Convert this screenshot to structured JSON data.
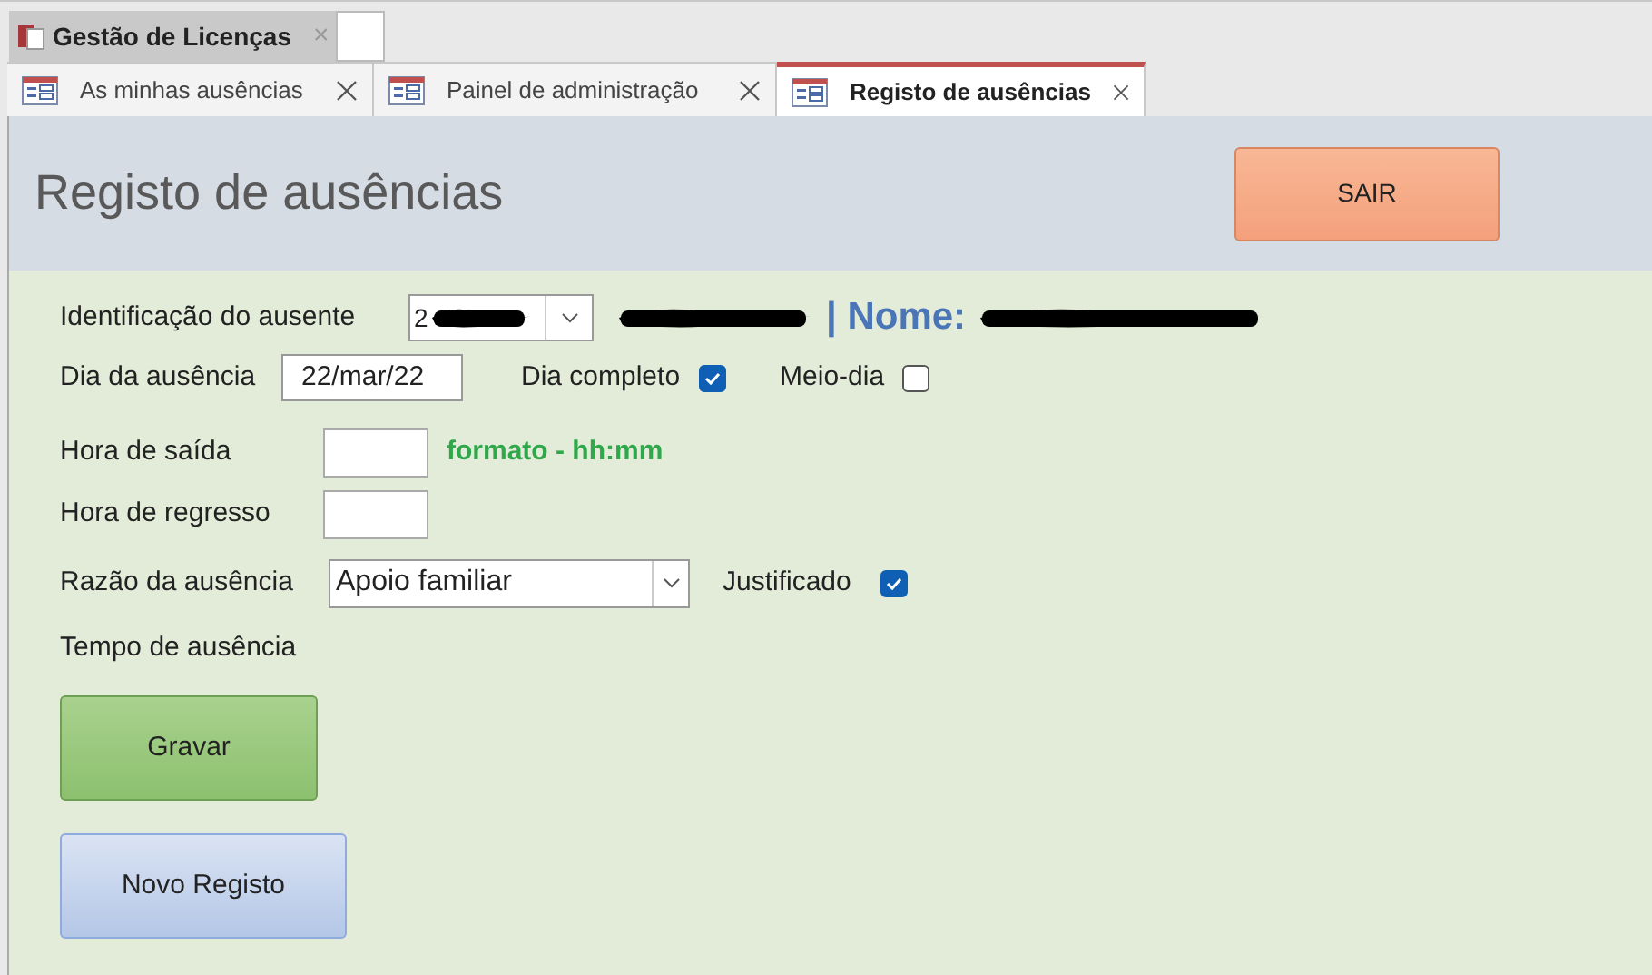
{
  "app_tab": {
    "title": "Gestão de Licenças",
    "close": "×"
  },
  "tabs": [
    {
      "label": "As minhas ausências",
      "selected": false
    },
    {
      "label": "Painel de administração",
      "selected": false
    },
    {
      "label": "Registo de ausências",
      "selected": true
    }
  ],
  "form": {
    "title": "Registo de ausências",
    "exit_button": "SAIR",
    "absentee": {
      "label": "Identificação do ausente",
      "value": "2",
      "heading": "| Nome:"
    },
    "absence_day": {
      "label": "Dia da ausência",
      "value": "22/mar/22"
    },
    "full_day": {
      "label": "Dia completo",
      "checked": true
    },
    "half_day": {
      "label": "Meio-dia",
      "checked": false
    },
    "leave_time": {
      "label": "Hora de saída",
      "hint": "formato - hh:mm"
    },
    "return_time": {
      "label": "Hora de regresso"
    },
    "reason": {
      "label": "Razão da ausência",
      "value": "Apoio familiar"
    },
    "justified": {
      "label": "Justificado",
      "checked": true
    },
    "duration": {
      "label": "Tempo de ausência"
    },
    "save_button": "Gravar",
    "new_button": "Novo Registo"
  }
}
